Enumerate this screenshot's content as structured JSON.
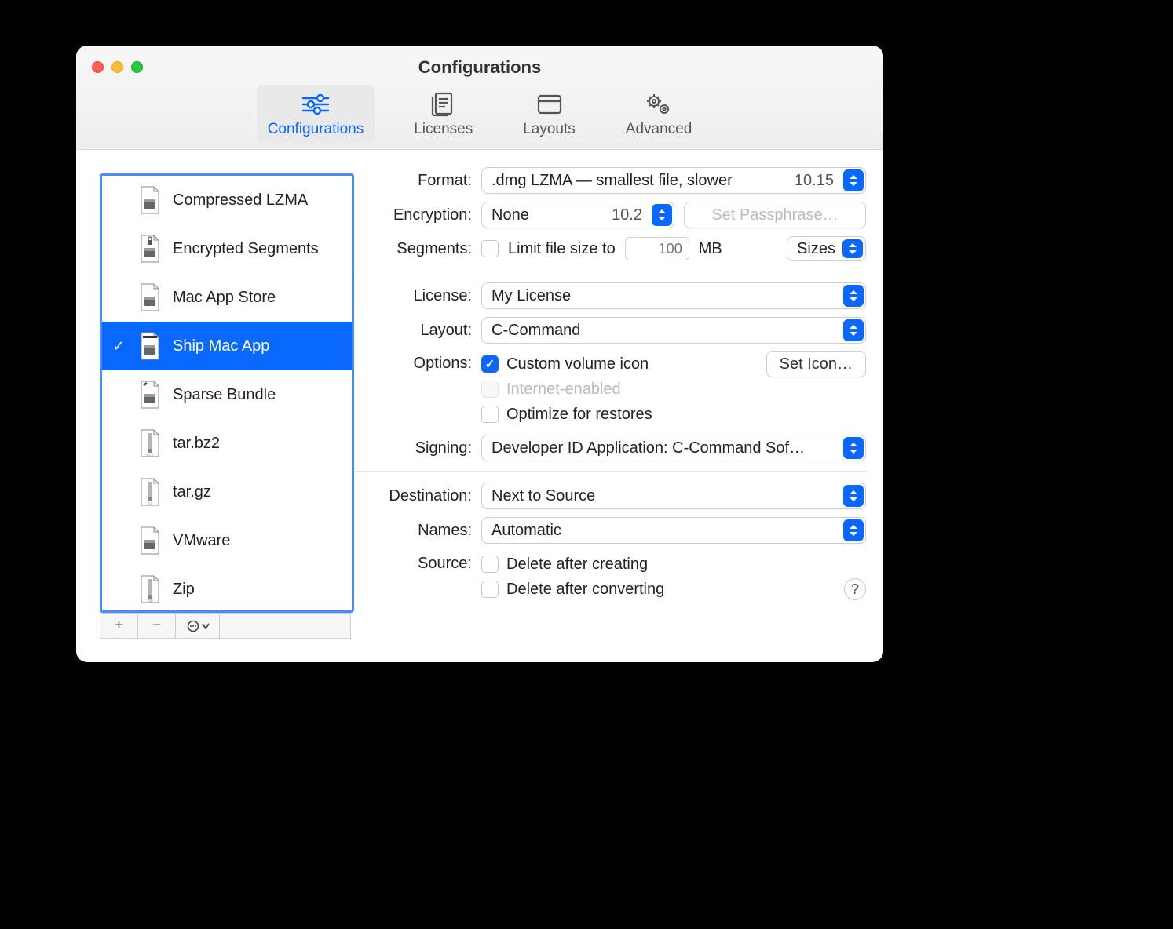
{
  "window": {
    "title": "Configurations"
  },
  "toolbar": {
    "active_index": 0,
    "items": [
      {
        "label": "Configurations",
        "icon": "sliders-icon"
      },
      {
        "label": "Licenses",
        "icon": "document-icon"
      },
      {
        "label": "Layouts",
        "icon": "window-icon"
      },
      {
        "label": "Advanced",
        "icon": "gears-icon"
      }
    ]
  },
  "sidebar": {
    "selected_index": 3,
    "items": [
      {
        "name": "Compressed LZMA",
        "icon": "dmg"
      },
      {
        "name": "Encrypted Segments",
        "icon": "dmg-lock"
      },
      {
        "name": "Mac App Store",
        "icon": "dmg"
      },
      {
        "name": "Ship Mac App",
        "icon": "dmg-check"
      },
      {
        "name": "Sparse Bundle",
        "icon": "dmg-edit"
      },
      {
        "name": "tar.bz2",
        "icon": "archive-bz2"
      },
      {
        "name": "tar.gz",
        "icon": "archive-gz"
      },
      {
        "name": "VMware",
        "icon": "dmg"
      },
      {
        "name": "Zip",
        "icon": "archive-zip"
      }
    ],
    "buttons": {
      "add": "+",
      "remove": "−",
      "menu": "⊙ ⌄"
    }
  },
  "form": {
    "format": {
      "label": "Format:",
      "value": ".dmg LZMA — smallest file, slower",
      "os_min": "10.15"
    },
    "encryption": {
      "label": "Encryption:",
      "value": "None",
      "os_min": "10.2",
      "passphrase_btn": "Set Passphrase…",
      "passphrase_enabled": false
    },
    "segments": {
      "label": "Segments:",
      "limit_label": "Limit file size to",
      "limit_checked": false,
      "size_value": "100",
      "size_unit": "MB",
      "sizes_label": "Sizes"
    },
    "license": {
      "label": "License:",
      "value": "My License"
    },
    "layout": {
      "label": "Layout:",
      "value": "C-Command"
    },
    "options": {
      "label": "Options:",
      "custom_volume_icon": {
        "label": "Custom volume icon",
        "checked": true,
        "set_icon_btn": "Set Icon…"
      },
      "internet_enabled": {
        "label": "Internet-enabled",
        "checked": false,
        "disabled": true
      },
      "optimize_restores": {
        "label": "Optimize for restores",
        "checked": false
      }
    },
    "signing": {
      "label": "Signing:",
      "value": "Developer ID Application: C-Command Sof…"
    },
    "destination": {
      "label": "Destination:",
      "value": "Next to Source"
    },
    "names": {
      "label": "Names:",
      "value": "Automatic"
    },
    "source": {
      "label": "Source:",
      "delete_after_creating": {
        "label": "Delete after creating",
        "checked": false
      },
      "delete_after_converting": {
        "label": "Delete after converting",
        "checked": false
      }
    },
    "help": "?"
  }
}
